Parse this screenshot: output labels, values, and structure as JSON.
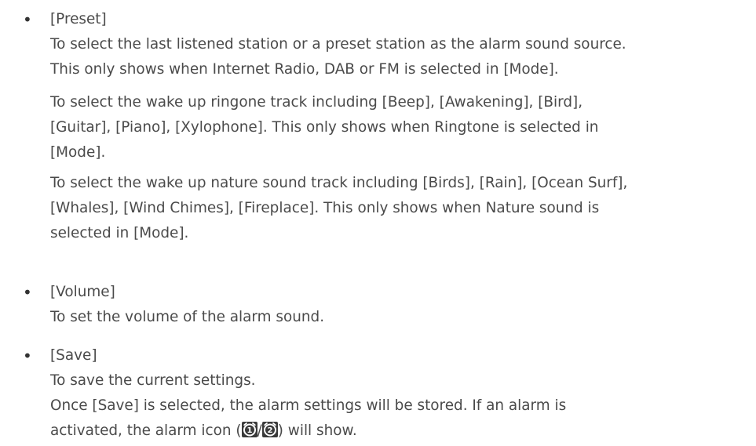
{
  "items": [
    {
      "term": "[Preset]",
      "paragraphs": [
        [
          "To select the last listened station or a preset station as the alarm sound source.",
          "This only shows when Internet Radio, DAB or FM is selected in [Mode]."
        ],
        [
          "To select the wake up ringone track including [Beep], [Awakening], [Bird],",
          "[Guitar], [Piano], [Xylophone]. This only shows when Ringtone is selected in",
          "[Mode]."
        ],
        [
          "To select the wake up nature sound track including [Birds], [Rain], [Ocean Surf],",
          "[Whales], [Wind Chimes], [Fireplace]. This only shows when Nature sound is",
          "selected in [Mode]."
        ]
      ]
    },
    {
      "term": "[Volume]",
      "paragraphs": [
        [
          "To set the volume of the alarm sound."
        ]
      ]
    },
    {
      "term": "[Save]",
      "paragraphs": [
        [
          "To save the current settings.",
          "Once [Save] is selected, the alarm settings will be stored. If an alarm is"
        ]
      ],
      "last_line": {
        "before": "activated, the alarm icon (",
        "separator": "/",
        "after": ") will show.",
        "icons": [
          {
            "name": "alarm-1-icon",
            "number": "1",
            "color": "#3a3a3a"
          },
          {
            "name": "alarm-2-icon",
            "number": "2",
            "color": "#3a3a3a"
          }
        ]
      }
    }
  ],
  "bullet_char": "•"
}
